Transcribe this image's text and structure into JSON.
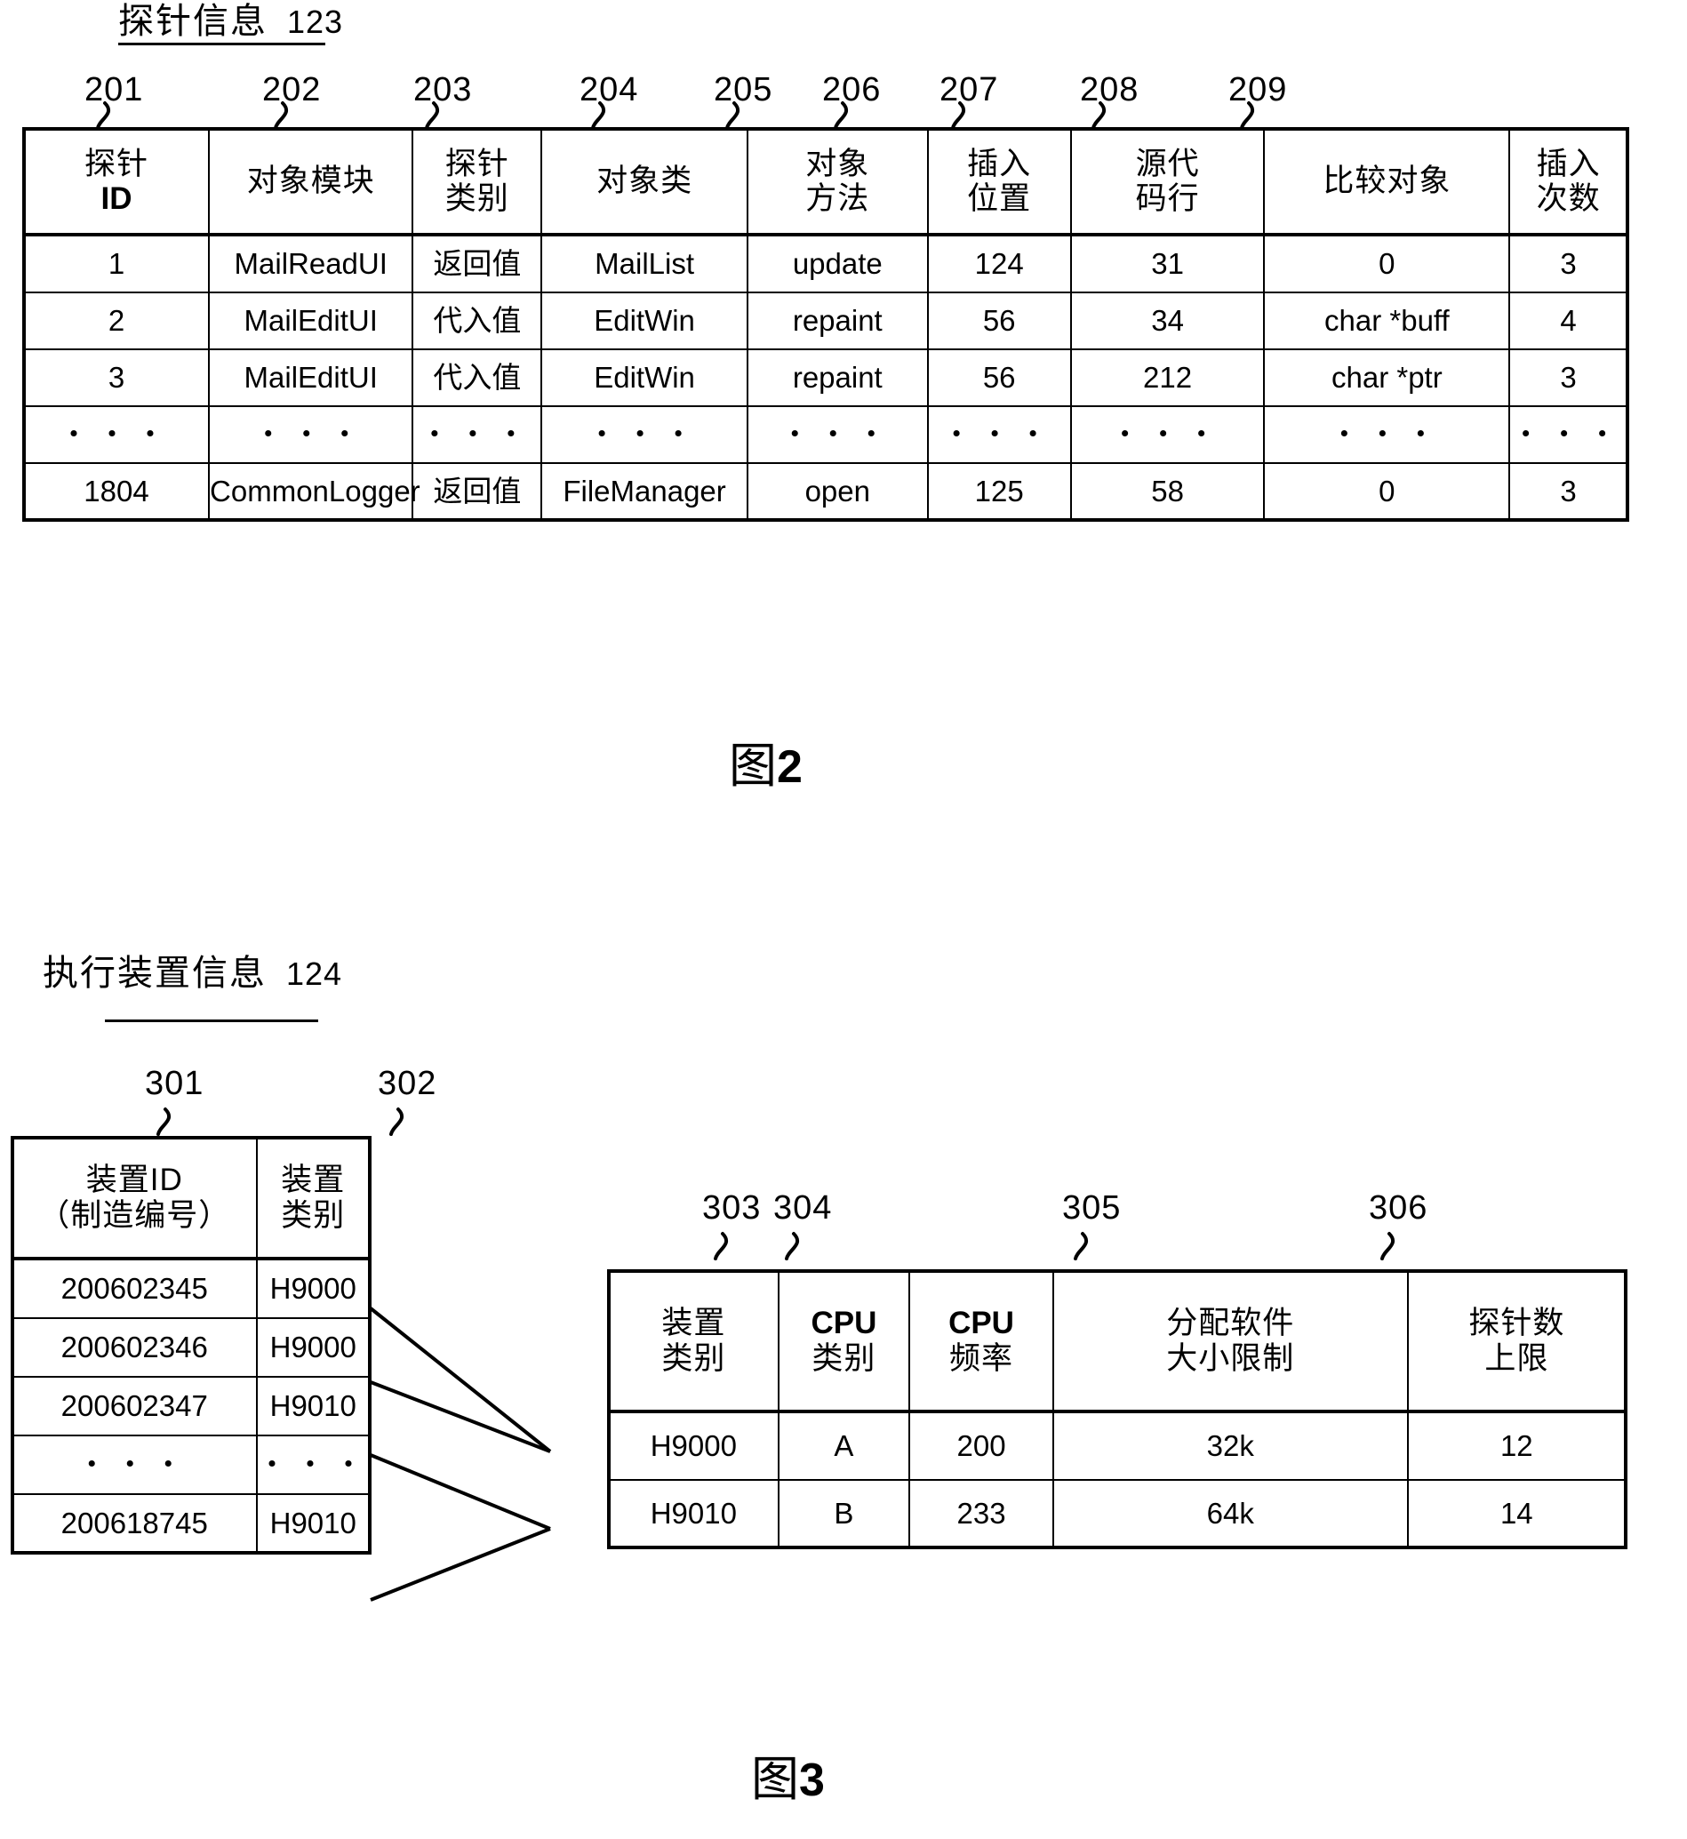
{
  "figure2": {
    "title": "探针信息",
    "title_ref": "123",
    "caption_cjk": "图",
    "caption_num": "2",
    "callouts": [
      "201",
      "202",
      "203",
      "204",
      "205",
      "206",
      "207",
      "208",
      "209"
    ],
    "table": {
      "headers": [
        {
          "line1": "探针",
          "line2": "ID",
          "bold2": true
        },
        {
          "line1": "对象模块",
          "line2": ""
        },
        {
          "line1": "探针",
          "line2": "类别"
        },
        {
          "line1": "对象类",
          "line2": ""
        },
        {
          "line1": "对象",
          "line2": "方法"
        },
        {
          "line1": "插入",
          "line2": "位置"
        },
        {
          "line1": "源代",
          "line2": "码行"
        },
        {
          "line1": "比较对象",
          "line2": ""
        },
        {
          "line1": "插入",
          "line2": "次数"
        }
      ],
      "rows": [
        [
          "1",
          "MailReadUI",
          "返回值",
          "MailList",
          "update",
          "124",
          "31",
          "0",
          "3"
        ],
        [
          "2",
          "MailEditUI",
          "代入值",
          "EditWin",
          "repaint",
          "56",
          "34",
          "char  *buff",
          "4"
        ],
        [
          "3",
          "MailEditUI",
          "代入值",
          "EditWin",
          "repaint",
          "56",
          "212",
          "char  *ptr",
          "3"
        ],
        [
          "・・・",
          "・・・",
          "・・・",
          "・・・",
          "・・・",
          "・・・",
          "・・・",
          "・・・",
          "・・・"
        ],
        [
          "1804",
          "CommonLogger",
          "返回值",
          "FileManager",
          "open",
          "125",
          "58",
          "0",
          "3"
        ]
      ]
    }
  },
  "figure3": {
    "title": "执行装置信息",
    "title_ref": "124",
    "caption_cjk": "图",
    "caption_num": "3",
    "left_callouts": [
      "301",
      "302"
    ],
    "right_callouts": [
      "303",
      "304",
      "305",
      "306"
    ],
    "device_table": {
      "headers": [
        {
          "line1": "装置ID",
          "line2": "（制造编号）"
        },
        {
          "line1": "装置",
          "line2": "类别"
        }
      ],
      "rows": [
        [
          "200602345",
          "H9000"
        ],
        [
          "200602346",
          "H9000"
        ],
        [
          "200602347",
          "H9010"
        ],
        [
          "・・・",
          "・・・"
        ],
        [
          "200618745",
          "H9010"
        ]
      ]
    },
    "spec_table": {
      "headers": [
        {
          "line1": "装置",
          "line2": "类别",
          "bold1": false
        },
        {
          "line1": "CPU",
          "line2": "类别",
          "bold1": true
        },
        {
          "line1": "CPU",
          "line2": "频率",
          "bold1": true
        },
        {
          "line1": "分配软件",
          "line2": "大小限制",
          "bold1": false
        },
        {
          "line1": "探针数",
          "line2": "上限",
          "bold1": false
        }
      ],
      "rows": [
        [
          "H9000",
          "A",
          "200",
          "32k",
          "12"
        ],
        [
          "H9010",
          "B",
          "233",
          "64k",
          "14"
        ]
      ]
    }
  }
}
